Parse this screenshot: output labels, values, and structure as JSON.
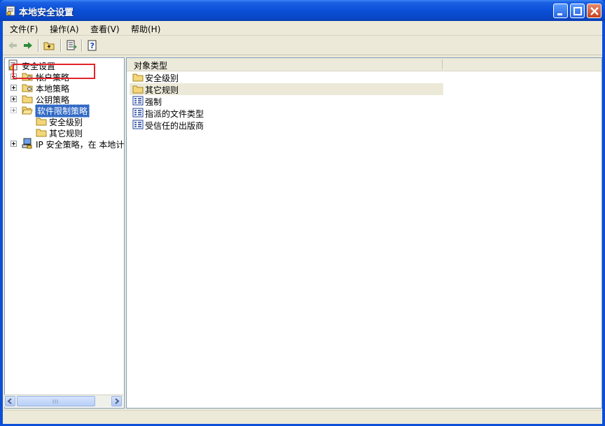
{
  "window": {
    "title": "本地安全设置",
    "icons": {
      "app": "security-settings-icon",
      "minimize": "minimize-icon",
      "maximize": "maximize-icon",
      "close": "close-icon"
    }
  },
  "menu": {
    "items": [
      {
        "label": "文件(F)"
      },
      {
        "label": "操作(A)"
      },
      {
        "label": "查看(V)"
      },
      {
        "label": "帮助(H)"
      }
    ]
  },
  "toolbar": {
    "buttons": [
      {
        "icon": "back-arrow-icon"
      },
      {
        "icon": "forward-arrow-icon"
      },
      {
        "icon": "up-folder-icon"
      },
      {
        "icon": "export-list-icon"
      },
      {
        "icon": "help-icon"
      }
    ]
  },
  "tree": {
    "root": {
      "label": "安全设置",
      "icon": "security-settings-icon"
    },
    "items": [
      {
        "label": "帐户策略",
        "icon": "folder-icon",
        "expandable": true
      },
      {
        "label": "本地策略",
        "icon": "folder-icon",
        "expandable": true
      },
      {
        "label": "公钥策略",
        "icon": "folder-icon",
        "expandable": true
      },
      {
        "label": "软件限制策略",
        "icon": "open-folder-icon",
        "expandable": false,
        "selected": true
      },
      {
        "label": "安全级别",
        "icon": "folder-icon",
        "child": true
      },
      {
        "label": "其它规则",
        "icon": "folder-icon",
        "child": true
      },
      {
        "label": "IP 安全策略，在 本地计",
        "icon": "computer-icon",
        "expandable": true
      }
    ]
  },
  "list": {
    "header": "对象类型",
    "rows": [
      {
        "label": "安全级别",
        "icon": "folder-icon"
      },
      {
        "label": "其它规则",
        "icon": "folder-icon"
      },
      {
        "label": "强制",
        "icon": "policy-icon"
      },
      {
        "label": "指派的文件类型",
        "icon": "policy-icon"
      },
      {
        "label": "受信任的出版商",
        "icon": "policy-icon"
      }
    ]
  },
  "colors": {
    "titlebar": "#0a4fd6",
    "selection": "#316ac5",
    "highlight_box": "#e3232a",
    "face": "#ece9d8"
  }
}
